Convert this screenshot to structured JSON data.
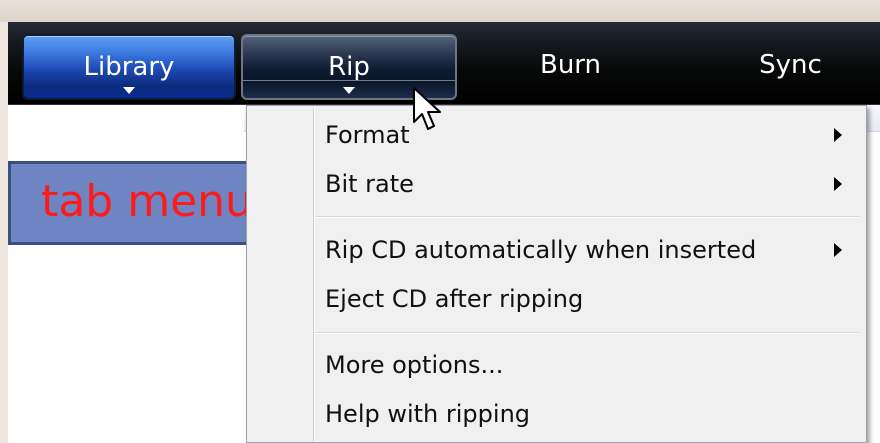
{
  "tabs": [
    {
      "label": "Library"
    },
    {
      "label": "Rip"
    },
    {
      "label": "Burn"
    },
    {
      "label": "Sync"
    }
  ],
  "annotation": {
    "text": "tab menu"
  },
  "menu": {
    "items": [
      {
        "label": "Format",
        "submenu": true
      },
      {
        "label": "Bit rate",
        "submenu": true
      },
      {
        "label": "Rip CD automatically when inserted",
        "submenu": true
      },
      {
        "label": "Eject CD after ripping",
        "submenu": false
      },
      {
        "label": "More options...",
        "submenu": false
      },
      {
        "label": "Help with ripping",
        "submenu": false
      }
    ]
  },
  "colors": {
    "annotation_fill": "#6f84c3",
    "annotation_text": "#ff1a1a",
    "library_tab": "#1c48b2",
    "menu_background": "#f0f0f0"
  }
}
